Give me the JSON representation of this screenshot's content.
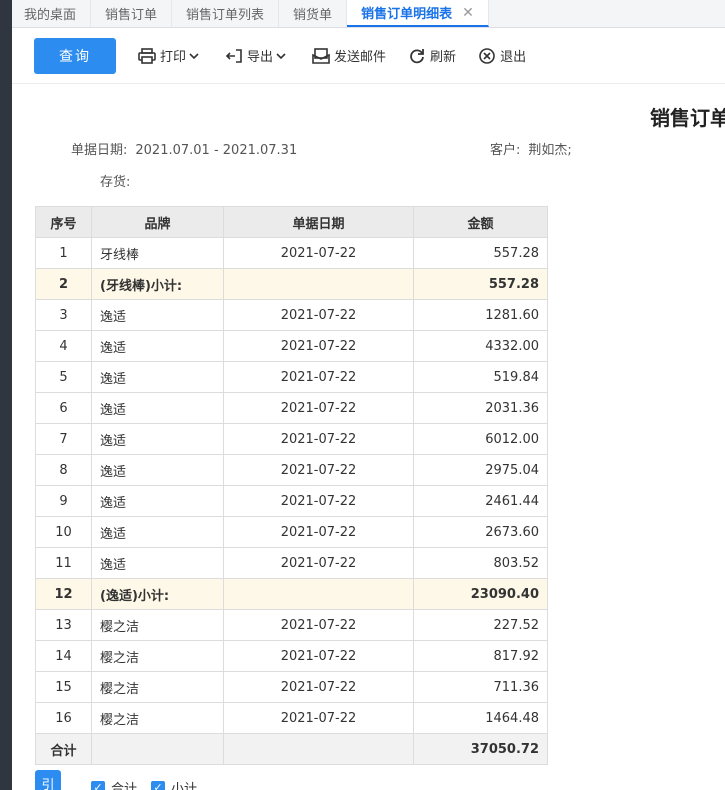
{
  "tabs": [
    {
      "label": "我的桌面"
    },
    {
      "label": "销售订单"
    },
    {
      "label": "销售订单列表"
    },
    {
      "label": "销货单"
    },
    {
      "label": "销售订单明细表",
      "active": true
    }
  ],
  "toolbar": {
    "query": "查询",
    "print": "打印",
    "export": "导出",
    "email": "发送邮件",
    "refresh": "刷新",
    "exit": "退出"
  },
  "report": {
    "title": "销售订单",
    "date_label": "单据日期:",
    "date_value": "2021.07.01 - 2021.07.31",
    "customer_label": "客户:",
    "customer_value": "荆如杰;",
    "stock_label": "存货:",
    "stock_value": ""
  },
  "table": {
    "headers": [
      "序号",
      "品牌",
      "单据日期",
      "金额"
    ],
    "rows": [
      {
        "no": "1",
        "brand": "牙线棒",
        "date": "2021-07-22",
        "amount": "557.28",
        "type": "row"
      },
      {
        "no": "2",
        "brand": "(牙线棒)小计:",
        "date": "",
        "amount": "557.28",
        "type": "subtotal"
      },
      {
        "no": "3",
        "brand": "逸适",
        "date": "2021-07-22",
        "amount": "1281.60",
        "type": "row"
      },
      {
        "no": "4",
        "brand": "逸适",
        "date": "2021-07-22",
        "amount": "4332.00",
        "type": "row"
      },
      {
        "no": "5",
        "brand": "逸适",
        "date": "2021-07-22",
        "amount": "519.84",
        "type": "row"
      },
      {
        "no": "6",
        "brand": "逸适",
        "date": "2021-07-22",
        "amount": "2031.36",
        "type": "row"
      },
      {
        "no": "7",
        "brand": "逸适",
        "date": "2021-07-22",
        "amount": "6012.00",
        "type": "row"
      },
      {
        "no": "8",
        "brand": "逸适",
        "date": "2021-07-22",
        "amount": "2975.04",
        "type": "row"
      },
      {
        "no": "9",
        "brand": "逸适",
        "date": "2021-07-22",
        "amount": "2461.44",
        "type": "row"
      },
      {
        "no": "10",
        "brand": "逸适",
        "date": "2021-07-22",
        "amount": "2673.60",
        "type": "row"
      },
      {
        "no": "11",
        "brand": "逸适",
        "date": "2021-07-22",
        "amount": "803.52",
        "type": "row"
      },
      {
        "no": "12",
        "brand": "(逸适)小计:",
        "date": "",
        "amount": "23090.40",
        "type": "subtotal"
      },
      {
        "no": "13",
        "brand": "樱之洁",
        "date": "2021-07-22",
        "amount": "227.52",
        "type": "row"
      },
      {
        "no": "14",
        "brand": "樱之洁",
        "date": "2021-07-22",
        "amount": "817.92",
        "type": "row"
      },
      {
        "no": "15",
        "brand": "樱之洁",
        "date": "2021-07-22",
        "amount": "711.36",
        "type": "row"
      },
      {
        "no": "16",
        "brand": "樱之洁",
        "date": "2021-07-22",
        "amount": "1464.48",
        "type": "row"
      }
    ],
    "total_label": "合计",
    "total_amount": "37050.72"
  },
  "bottom": {
    "button_label": "引",
    "checkbox_total": "合计",
    "checkbox_subtotal": "小计"
  },
  "colors": {
    "accent": "#2d8cf0",
    "subtotal_bg": "#fdf8e8",
    "header_bg": "#ebebeb"
  }
}
